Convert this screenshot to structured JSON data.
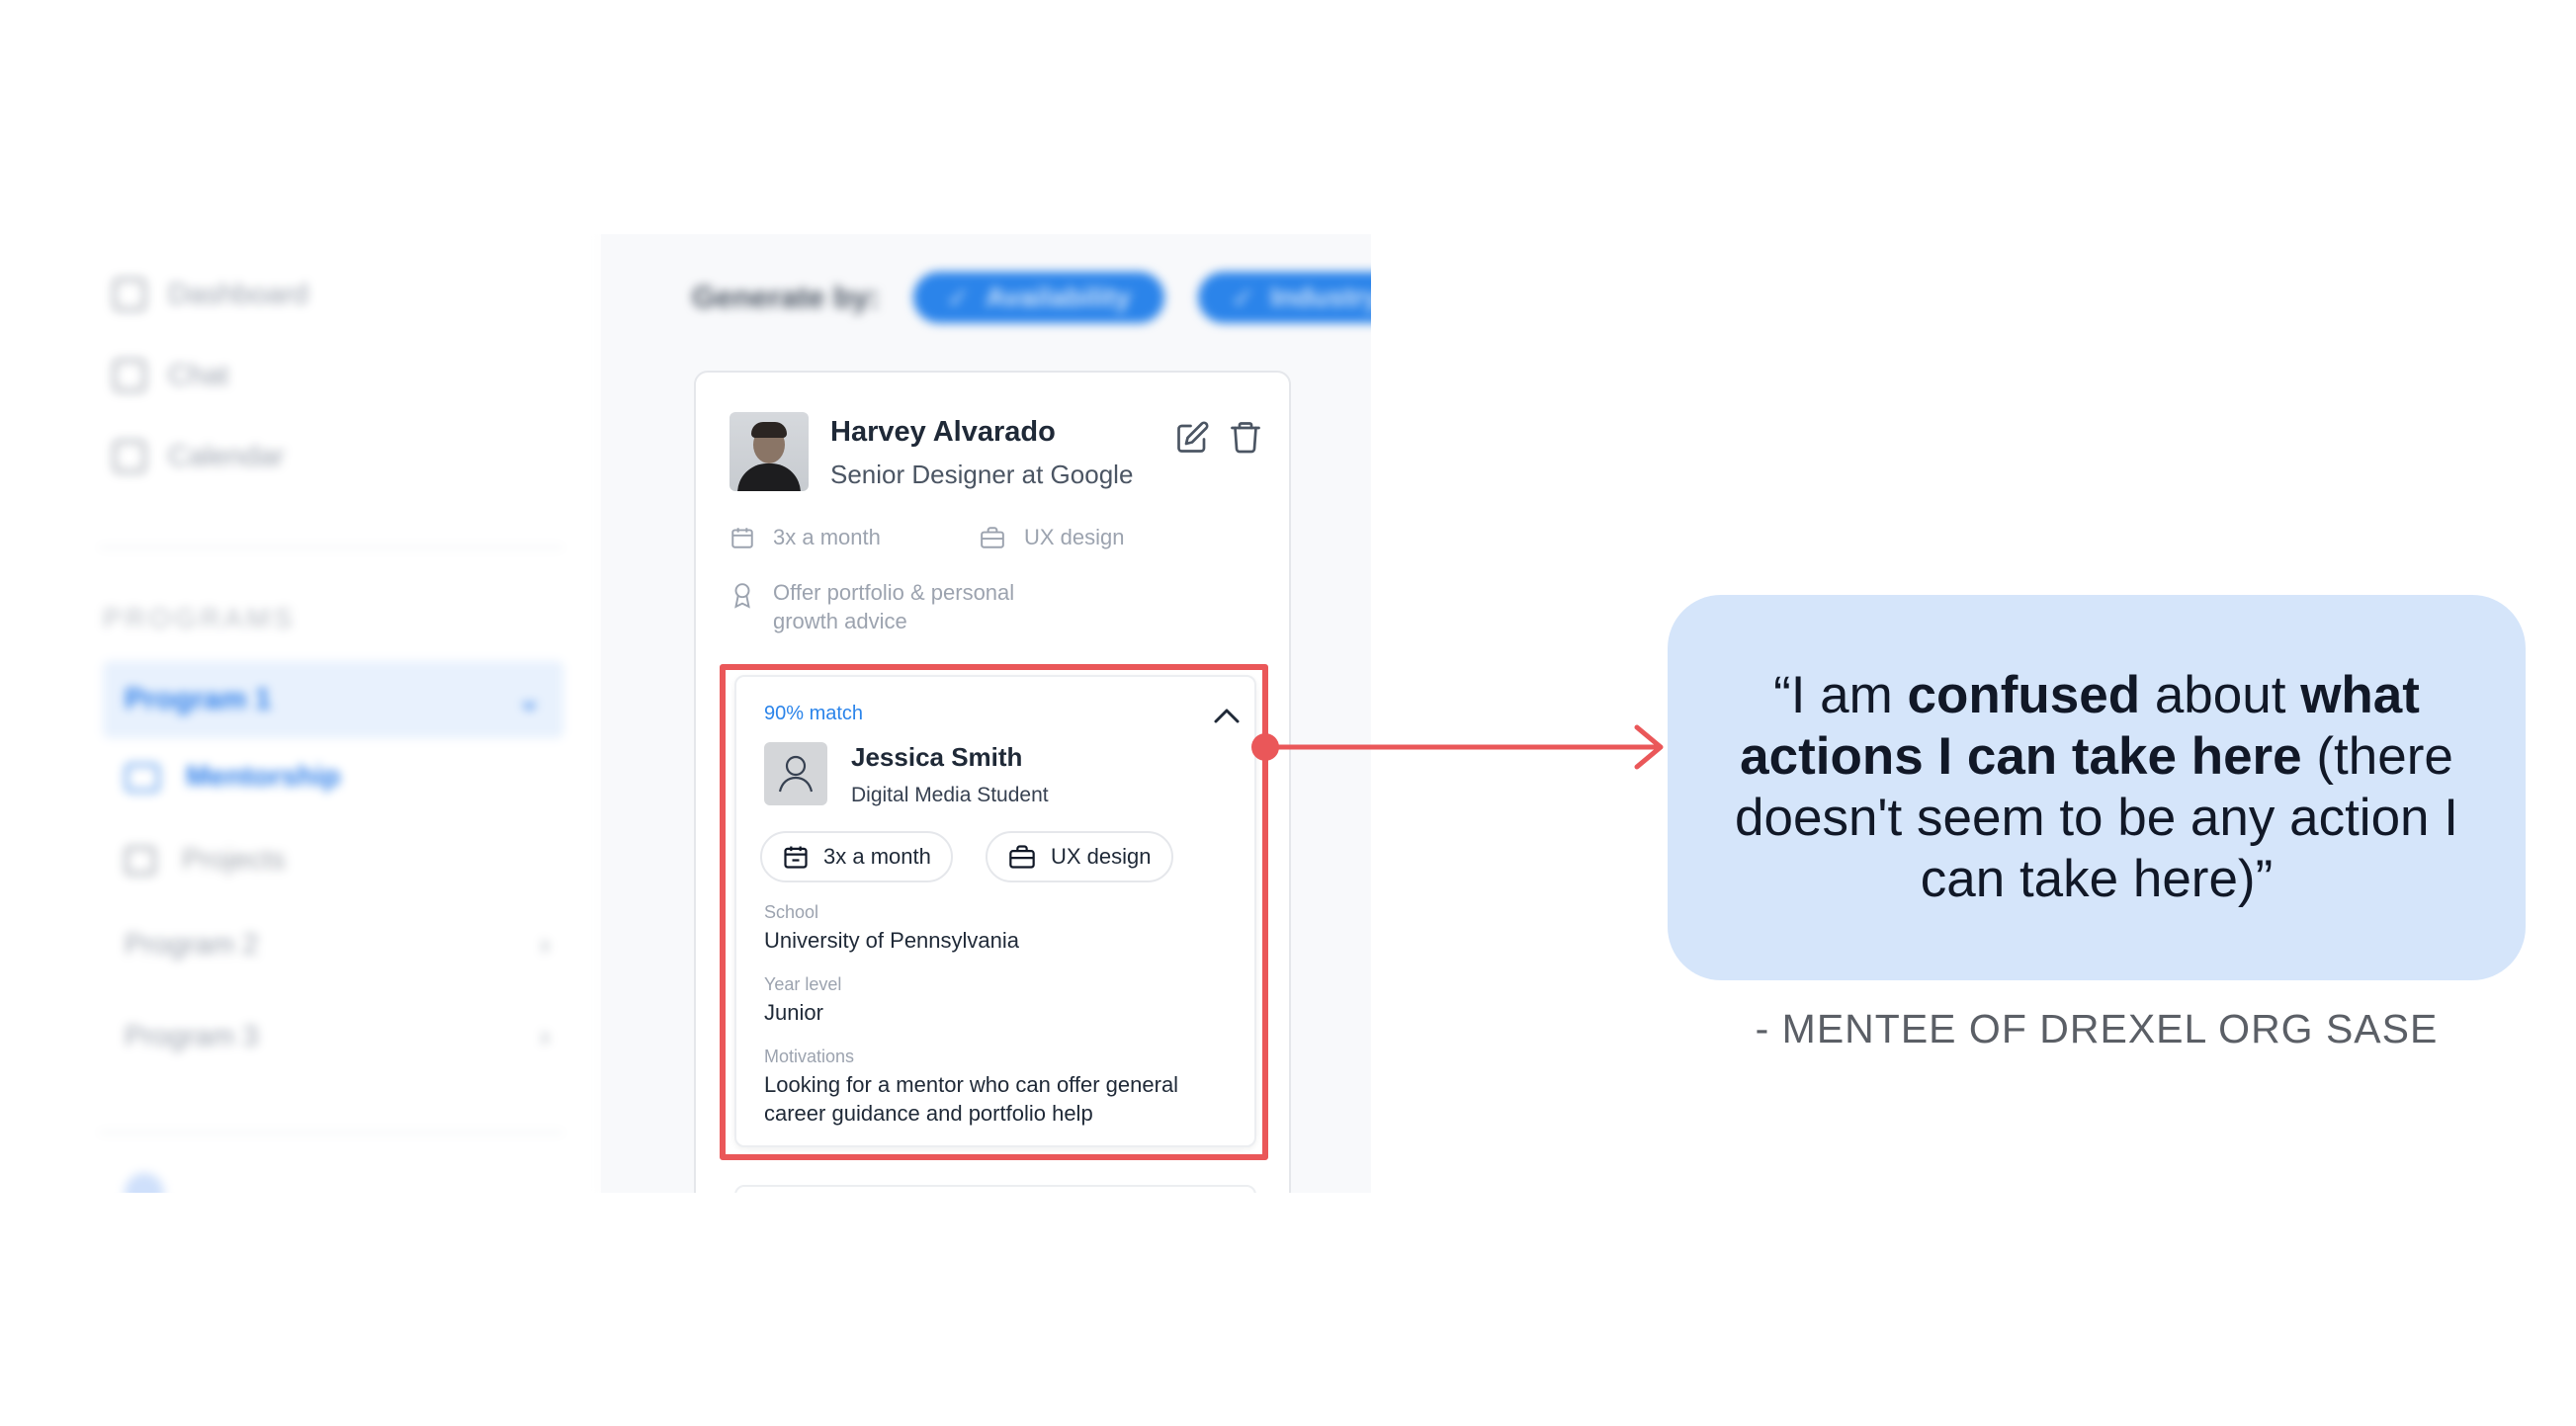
{
  "sidebar": {
    "nav": [
      {
        "label": "Dashboard",
        "icon": "dashboard-icon"
      },
      {
        "label": "Chat",
        "icon": "chat-icon"
      },
      {
        "label": "Calendar",
        "icon": "calendar-icon"
      }
    ],
    "programs_heading": "PROGRAMS",
    "program_1": {
      "label": "Program 1",
      "sub_items": [
        {
          "label": "Mentorship",
          "icon": "mentorship-icon"
        },
        {
          "label": "Projects",
          "icon": "projects-icon"
        }
      ]
    },
    "program_2": "Program 2",
    "program_3": "Program 3"
  },
  "main": {
    "generate_by_label": "Generate by:",
    "filters": [
      {
        "label": "Availability"
      },
      {
        "label": "Industry"
      }
    ],
    "mentor": {
      "name": "Harvey Alvarado",
      "title": "Senior Designer at Google",
      "frequency": "3x a month",
      "specialty": "UX design",
      "offer": "Offer portfolio & personal growth advice"
    },
    "mentee": {
      "match": "90% match",
      "name": "Jessica Smith",
      "role": "Digital Media Student",
      "frequency": "3x a month",
      "specialty": "UX design",
      "school_label": "School",
      "school": "University of Pennsylvania",
      "year_label": "Year level",
      "year": "Junior",
      "motivations_label": "Motivations",
      "motivations": "Looking for a mentor who can offer general career guidance and portfolio help"
    }
  },
  "annotation": {
    "quote": {
      "open": "“I am ",
      "em1": "confused",
      "mid": " about ",
      "em2": "what actions I can take here",
      "rest": " (there doesn't seem to be any action I can take here)”"
    },
    "attribution": "- MENTEE OF DREXEL ORG SASE"
  },
  "colors": {
    "accent_blue": "#2b84ea",
    "highlight_red": "#ea5759",
    "quote_background": "#d5e5fa"
  }
}
